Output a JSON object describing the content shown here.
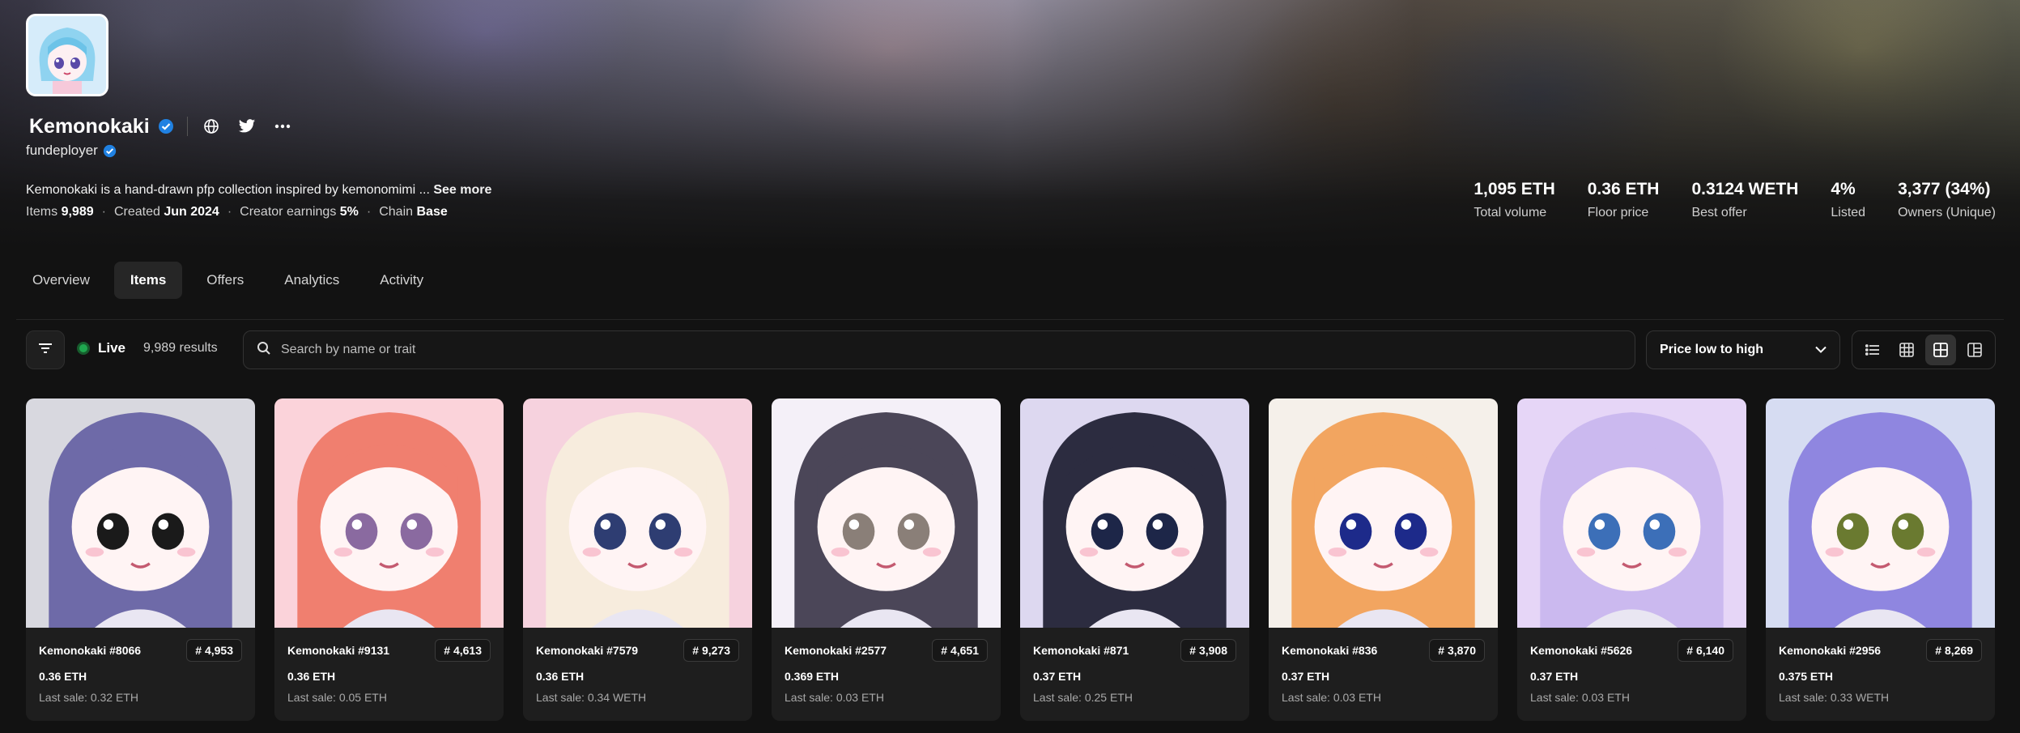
{
  "collection": {
    "name": "Kemonokaki",
    "creator": "fundeployer",
    "description": "Kemonokaki is a hand-drawn pfp collection inspired by kemonomimi ...",
    "see_more": "See more",
    "items_label": "Items",
    "items_value": "9,989",
    "created_label": "Created",
    "created_value": "Jun 2024",
    "earnings_label": "Creator earnings",
    "earnings_value": "5%",
    "chain_label": "Chain",
    "chain_value": "Base"
  },
  "stats": [
    {
      "value": "1,095 ETH",
      "label": "Total volume"
    },
    {
      "value": "0.36 ETH",
      "label": "Floor price"
    },
    {
      "value": "0.3124 WETH",
      "label": "Best offer"
    },
    {
      "value": "4%",
      "label": "Listed"
    },
    {
      "value": "3,377 (34%)",
      "label": "Owners (Unique)"
    }
  ],
  "tabs": [
    "Overview",
    "Items",
    "Offers",
    "Analytics",
    "Activity"
  ],
  "active_tab": "Items",
  "toolbar": {
    "live_label": "Live",
    "results": "9,989 results",
    "search_placeholder": "Search by name or trait",
    "sort_label": "Price low to high"
  },
  "colors": {
    "live": "#1fa84f",
    "verified": "#2081e2"
  },
  "items": [
    {
      "name": "Kemonokaki #8066",
      "rank": "# 4,953",
      "price": "0.36 ETH",
      "last_sale": "Last sale: 0.32 ETH",
      "hair": "#6e6aa8",
      "bg": "#d8d8df",
      "eye": "#1a1a1a"
    },
    {
      "name": "Kemonokaki #9131",
      "rank": "# 4,613",
      "price": "0.36 ETH",
      "last_sale": "Last sale: 0.05 ETH",
      "hair": "#f07f6f",
      "bg": "#fbd3da",
      "eye": "#8a6aa0"
    },
    {
      "name": "Kemonokaki #7579",
      "rank": "# 9,273",
      "price": "0.36 ETH",
      "last_sale": "Last sale: 0.34 WETH",
      "hair": "#f7ecdd",
      "bg": "#f6d2de",
      "eye": "#2e3d72"
    },
    {
      "name": "Kemonokaki #2577",
      "rank": "# 4,651",
      "price": "0.369 ETH",
      "last_sale": "Last sale: 0.03 ETH",
      "hair": "#4b4658",
      "bg": "#f4f0f8",
      "eye": "#8a7f78"
    },
    {
      "name": "Kemonokaki #871",
      "rank": "# 3,908",
      "price": "0.37 ETH",
      "last_sale": "Last sale: 0.25 ETH",
      "hair": "#2c2c40",
      "bg": "#ddd8f0",
      "eye": "#1d2648"
    },
    {
      "name": "Kemonokaki #836",
      "rank": "# 3,870",
      "price": "0.37 ETH",
      "last_sale": "Last sale: 0.03 ETH",
      "hair": "#f2a560",
      "bg": "#f5f0ea",
      "eye": "#1d2a8a"
    },
    {
      "name": "Kemonokaki #5626",
      "rank": "# 6,140",
      "price": "0.37 ETH",
      "last_sale": "Last sale: 0.03 ETH",
      "hair": "#cbb9ef",
      "bg": "#e6d6f7",
      "eye": "#3c6fb8"
    },
    {
      "name": "Kemonokaki #2956",
      "rank": "# 8,269",
      "price": "0.375 ETH",
      "last_sale": "Last sale: 0.33 WETH",
      "hair": "#8f86e0",
      "bg": "#d6dcf2",
      "eye": "#6a7a30"
    }
  ]
}
